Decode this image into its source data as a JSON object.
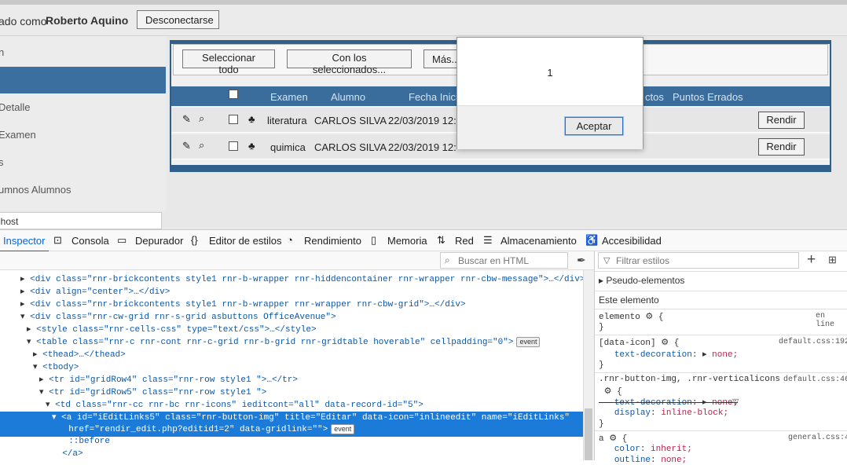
{
  "header": {
    "login_prefix": "ado como",
    "user_name": "Roberto Aquino",
    "logout_button": "Desconectarse"
  },
  "sidebar": {
    "items": [
      {
        "label": "n"
      },
      {
        "label": ""
      },
      {
        "label": "Detalle"
      },
      {
        "label": "Examen"
      },
      {
        "label": "s"
      },
      {
        "label": "umnos Alumnos"
      }
    ],
    "host": "lhost"
  },
  "grid": {
    "toolbar": {
      "select_all": "Seleccionar todo",
      "with_selected": "Con los seleccionados...",
      "more": "Más..."
    },
    "columns": {
      "exam": "Examen",
      "student": "Alumno",
      "date": "Fecha Inici",
      "correct": "ctos",
      "wrong": "Puntos Errados"
    },
    "rows": [
      {
        "exam": "literatura",
        "student": "CARLOS SILVA",
        "date": "22/03/2019 12:",
        "action": "Rendir"
      },
      {
        "exam": "quimica",
        "student": "CARLOS SILVA",
        "date": "22/03/2019 12:",
        "action": "Rendir"
      }
    ]
  },
  "dialog": {
    "message": "1",
    "ok_button": "Aceptar"
  },
  "devtools": {
    "tabs": [
      "Inspector",
      "Consola",
      "Depurador",
      "Editor de estilos",
      "Rendimiento",
      "Memoria",
      "Red",
      "Almacenamiento",
      "Accesibilidad"
    ],
    "search_placeholder": "Buscar en HTML",
    "filter_placeholder": "Filtrar estilos",
    "html_lines": [
      {
        "indent": 2,
        "text": "<div class=\"rnr-brickcontents style1 rnr-b-wrapper rnr-hiddencontainer rnr-wrapper rnr-cbw-message\">…</div>"
      },
      {
        "indent": 2,
        "text": "<div align=\"center\">…</div>"
      },
      {
        "indent": 2,
        "text": "<div class=\"rnr-brickcontents style1 rnr-b-wrapper rnr-wrapper rnr-cbw-grid\">…</div>"
      },
      {
        "indent": 2,
        "text": "<div class=\"rnr-cw-grid rnr-s-grid asbuttons OfficeAvenue\">"
      },
      {
        "indent": 3,
        "text": "<style class=\"rnr-cells-css\" type=\"text/css\">…</style>"
      },
      {
        "indent": 3,
        "text": "<table class=\"rnr-c rnr-cont rnr-c-grid rnr-b-grid rnr-gridtable hoverable\" cellpadding=\"0\">",
        "badge": "event"
      },
      {
        "indent": 4,
        "text": "<thead>…</thead>"
      },
      {
        "indent": 4,
        "text": "<tbody>"
      },
      {
        "indent": 5,
        "text": "<tr id=\"gridRow4\" class=\"rnr-row style1 \">…</tr>"
      },
      {
        "indent": 5,
        "text": "<tr id=\"gridRow5\" class=\"rnr-row style1 \">"
      },
      {
        "indent": 6,
        "text": "<td class=\"rnr-cc rnr-bc rnr-icons\" ieditcont=\"all\" data-record-id=\"5\">"
      },
      {
        "indent": 7,
        "text": "<a id=\"iEditLinks5\" class=\"rnr-button-img\" title=\"Editar\" data-icon=\"inlineedit\" name=\"iEditLinks\""
      },
      {
        "indent": 8,
        "text": "href=\"rendir_edit.php?editid1=2\" data-gridlink=\"\">",
        "badge": "event"
      },
      {
        "indent": 8,
        "text": "::before"
      },
      {
        "indent": 7,
        "text": "</a>"
      }
    ],
    "rules": {
      "pseudo": "Pseudo-elementos",
      "this_element": "Este elemento",
      "r1_selector": "elemento",
      "r1_src": "en líne",
      "r2_selector": "[data-icon]",
      "r2_src": "default.css:192",
      "r2_prop": "text-decoration",
      "r2_val": "none;",
      "r3_selector": ".rnr-button-img, .rnr-verticalicons",
      "r3_src": "default.css:46",
      "r3_prop1": "text-decoration",
      "r3_val1": "none;",
      "r3_prop2": "display",
      "r3_val2": "inline-block;",
      "r4_selector": "a",
      "r4_src": "general.css:4",
      "r4_prop1": "color",
      "r4_val1": "inherit;",
      "r4_prop2": "outline",
      "r4_val2": "none;"
    }
  }
}
